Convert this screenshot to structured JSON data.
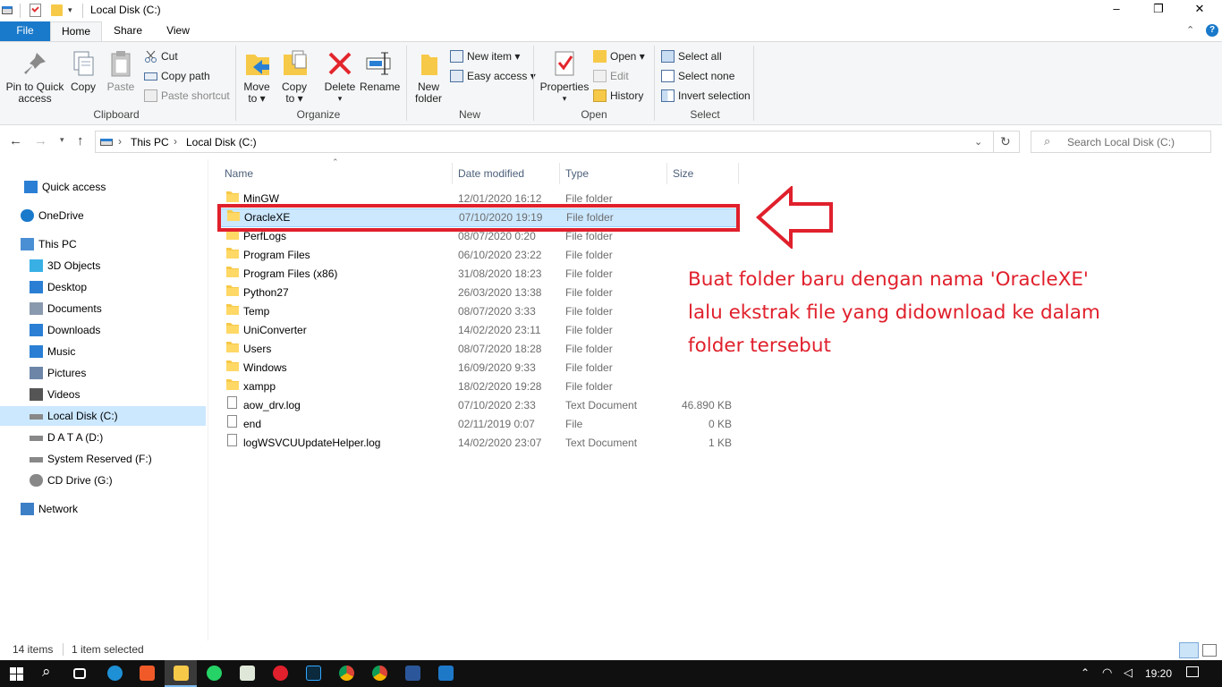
{
  "window": {
    "title": "Local Disk (C:)",
    "controls": {
      "minimize": "–",
      "maximize": "❐",
      "close": "✕"
    }
  },
  "ribbon_tabs": [
    {
      "label": "File"
    },
    {
      "label": "Home"
    },
    {
      "label": "Share"
    },
    {
      "label": "View"
    }
  ],
  "ribbon": {
    "clipboard": {
      "pin": "Pin to Quick",
      "pin2": "access",
      "copy": "Copy",
      "paste": "Paste",
      "cut": "Cut",
      "copy_path": "Copy path",
      "paste_shortcut": "Paste shortcut",
      "label": "Clipboard"
    },
    "organize": {
      "move": "Move",
      "move2": "to",
      "copy": "Copy",
      "copy2": "to",
      "delete": "Delete",
      "rename": "Rename",
      "label": "Organize"
    },
    "new": {
      "new_folder": "New",
      "new_folder2": "folder",
      "new_item": "New item",
      "easy_access": "Easy access",
      "label": "New"
    },
    "open": {
      "properties": "Properties",
      "open": "Open",
      "edit": "Edit",
      "history": "History",
      "label": "Open"
    },
    "select": {
      "select_all": "Select all",
      "select_none": "Select none",
      "invert": "Invert selection",
      "label": "Select"
    }
  },
  "address": {
    "crumbs": [
      "This PC",
      "Local Disk (C:)"
    ],
    "search_placeholder": "Search Local Disk (C:)"
  },
  "sidebar": {
    "items": [
      {
        "label": "Quick access",
        "icon": "star-icon"
      },
      {
        "label": "OneDrive",
        "icon": "cloud-icon"
      },
      {
        "label": "This PC",
        "icon": "computer-icon"
      },
      {
        "label": "3D Objects",
        "icon": "cube-icon"
      },
      {
        "label": "Desktop",
        "icon": "desktop-icon"
      },
      {
        "label": "Documents",
        "icon": "document-icon"
      },
      {
        "label": "Downloads",
        "icon": "download-icon"
      },
      {
        "label": "Music",
        "icon": "music-icon"
      },
      {
        "label": "Pictures",
        "icon": "picture-icon"
      },
      {
        "label": "Videos",
        "icon": "video-icon"
      },
      {
        "label": "Local Disk (C:)",
        "icon": "drive-icon"
      },
      {
        "label": "D A T A (D:)",
        "icon": "drive-icon"
      },
      {
        "label": "System Reserved (F:)",
        "icon": "drive-icon"
      },
      {
        "label": "CD Drive (G:)",
        "icon": "cd-icon"
      },
      {
        "label": "Network",
        "icon": "network-icon"
      }
    ]
  },
  "columns": {
    "name": "Name",
    "date": "Date modified",
    "type": "Type",
    "size": "Size"
  },
  "files": [
    {
      "name": "MinGW",
      "date": "12/01/2020 16:12",
      "type": "File folder",
      "size": "",
      "kind": "folder"
    },
    {
      "name": "OracleXE",
      "date": "07/10/2020 19:19",
      "type": "File folder",
      "size": "",
      "kind": "folder"
    },
    {
      "name": "PerfLogs",
      "date": "08/07/2020 0:20",
      "type": "File folder",
      "size": "",
      "kind": "folder"
    },
    {
      "name": "Program Files",
      "date": "06/10/2020 23:22",
      "type": "File folder",
      "size": "",
      "kind": "folder"
    },
    {
      "name": "Program Files (x86)",
      "date": "31/08/2020 18:23",
      "type": "File folder",
      "size": "",
      "kind": "folder"
    },
    {
      "name": "Python27",
      "date": "26/03/2020 13:38",
      "type": "File folder",
      "size": "",
      "kind": "folder"
    },
    {
      "name": "Temp",
      "date": "08/07/2020 3:33",
      "type": "File folder",
      "size": "",
      "kind": "folder"
    },
    {
      "name": "UniConverter",
      "date": "14/02/2020 23:11",
      "type": "File folder",
      "size": "",
      "kind": "folder"
    },
    {
      "name": "Users",
      "date": "08/07/2020 18:28",
      "type": "File folder",
      "size": "",
      "kind": "folder"
    },
    {
      "name": "Windows",
      "date": "16/09/2020 9:33",
      "type": "File folder",
      "size": "",
      "kind": "folder"
    },
    {
      "name": "xampp",
      "date": "18/02/2020 19:28",
      "type": "File folder",
      "size": "",
      "kind": "folder"
    },
    {
      "name": "aow_drv.log",
      "date": "07/10/2020 2:33",
      "type": "Text Document",
      "size": "46.890 KB",
      "kind": "file"
    },
    {
      "name": "end",
      "date": "02/11/2019 0:07",
      "type": "File",
      "size": "0 KB",
      "kind": "file"
    },
    {
      "name": "logWSVCUUpdateHelper.log",
      "date": "14/02/2020 23:07",
      "type": "Text Document",
      "size": "1 KB",
      "kind": "file"
    }
  ],
  "annotation": {
    "line1": "Buat folder baru dengan nama 'OracleXE'",
    "line2": "lalu ekstrak file yang didownload ke dalam",
    "line3": "folder tersebut",
    "color": "#e0202c"
  },
  "status": {
    "items": "14 items",
    "selected": "1 item selected"
  },
  "taskbar": {
    "time": "19:20"
  }
}
